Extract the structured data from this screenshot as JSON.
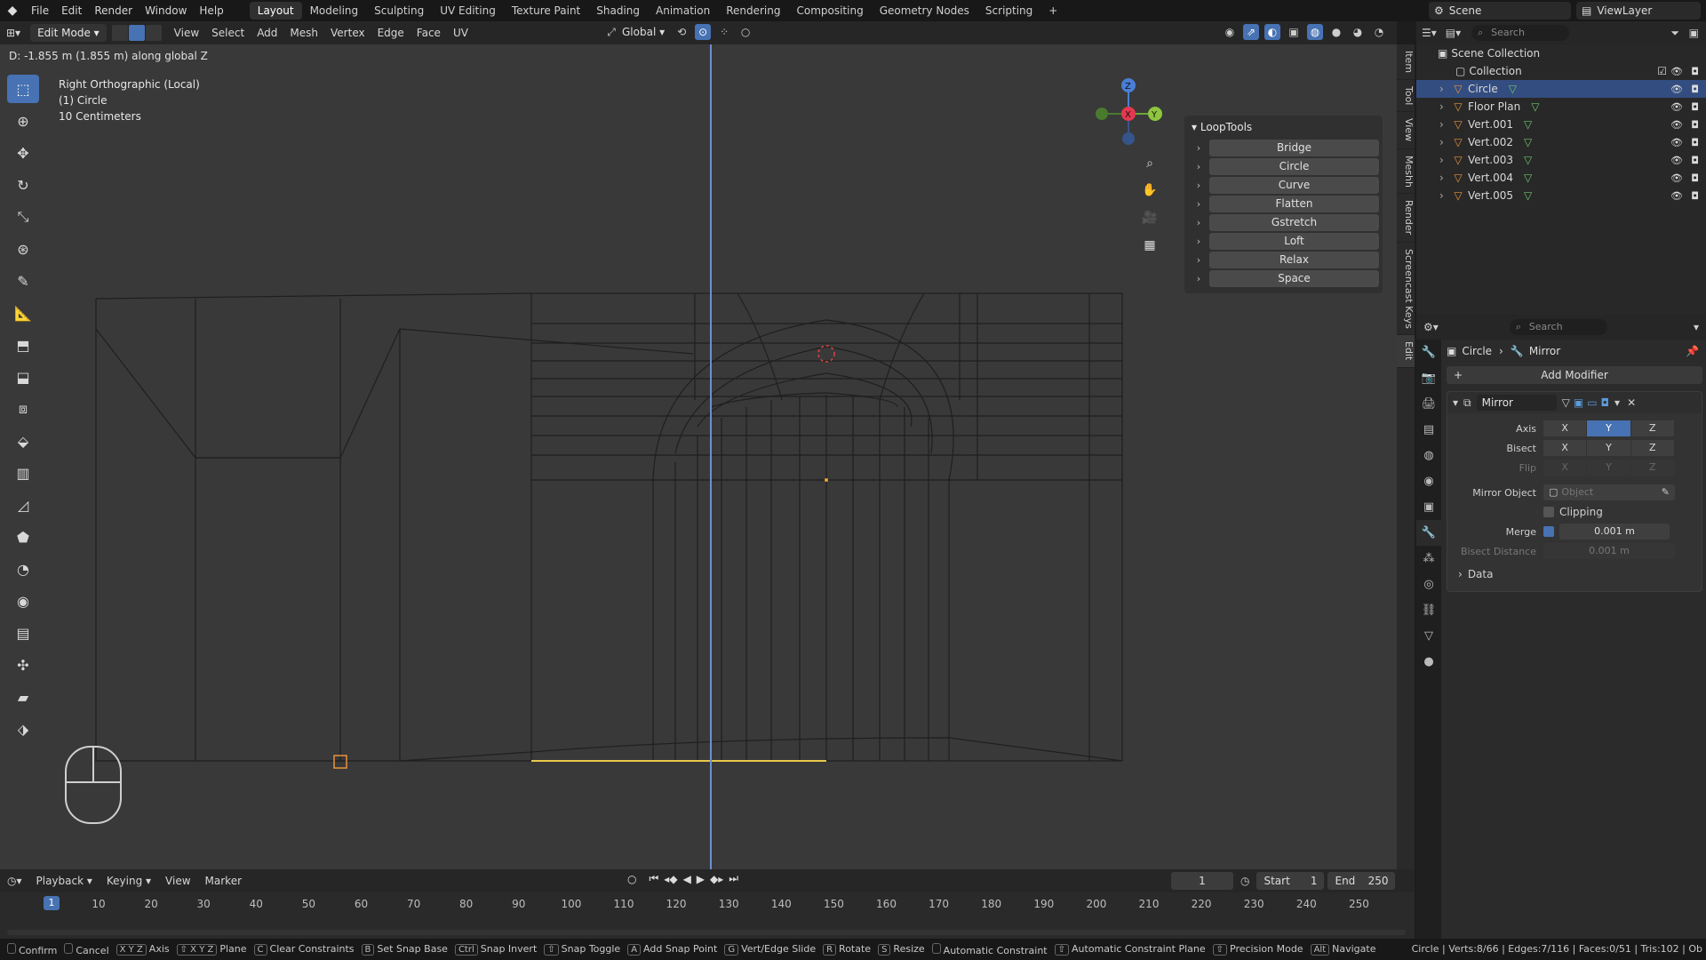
{
  "menu": {
    "items": [
      "File",
      "Edit",
      "Render",
      "Window",
      "Help"
    ],
    "workspaces": [
      "Layout",
      "Modeling",
      "Sculpting",
      "UV Editing",
      "Texture Paint",
      "Shading",
      "Animation",
      "Rendering",
      "Compositing",
      "Geometry Nodes",
      "Scripting"
    ],
    "active_workspace": "Layout",
    "scene": "Scene",
    "view_layer": "ViewLayer"
  },
  "viewport_header": {
    "mode": "Edit Mode",
    "menus": [
      "View",
      "Select",
      "Add",
      "Mesh",
      "Vertex",
      "Edge",
      "Face",
      "UV"
    ],
    "transform_orientation": "Global"
  },
  "viewport": {
    "status_line": "D: -1.855 m (1.855 m) along global Z",
    "view_name": "Right Orthographic (Local)",
    "object_name": "(1) Circle",
    "grid_scale": "10 Centimeters",
    "gizmo_axes": {
      "z": "Z",
      "x": "X",
      "y": "Y"
    }
  },
  "n_panel_tabs": [
    "Item",
    "Tool",
    "View",
    "Meshh",
    "Render",
    "Screencast Keys",
    "Edit"
  ],
  "looptools": {
    "title": "LoopTools",
    "items": [
      "Bridge",
      "Circle",
      "Curve",
      "Flatten",
      "Gstretch",
      "Loft",
      "Relax",
      "Space"
    ]
  },
  "timeline": {
    "menus": [
      "Playback",
      "Keying",
      "View",
      "Marker"
    ],
    "current_frame": "1",
    "start_label": "Start",
    "start": "1",
    "end_label": "End",
    "end": "250",
    "ruler": [
      "10",
      "20",
      "30",
      "40",
      "50",
      "60",
      "70",
      "80",
      "90",
      "100",
      "110",
      "120",
      "130",
      "140",
      "150",
      "160",
      "170",
      "180",
      "190",
      "200",
      "210",
      "220",
      "230",
      "240",
      "250"
    ],
    "cursor_frame": "1"
  },
  "statusbar": {
    "items": [
      {
        "key": "",
        "label": "Confirm"
      },
      {
        "key": "",
        "label": "Cancel"
      },
      {
        "key": "X Y Z",
        "label": "Axis"
      },
      {
        "key": "⇧ X Y Z",
        "label": "Plane"
      },
      {
        "key": "C",
        "label": "Clear Constraints"
      },
      {
        "key": "B",
        "label": "Set Snap Base"
      },
      {
        "key": "Ctrl",
        "label": "Snap Invert"
      },
      {
        "key": "⇧",
        "label": "Snap Toggle"
      },
      {
        "key": "A",
        "label": "Add Snap Point"
      },
      {
        "key": "G",
        "label": "Vert/Edge Slide"
      },
      {
        "key": "R",
        "label": "Rotate"
      },
      {
        "key": "S",
        "label": "Resize"
      },
      {
        "key": "",
        "label": "Automatic Constraint"
      },
      {
        "key": "⇧",
        "label": "Automatic Constraint Plane"
      },
      {
        "key": "⇧",
        "label": "Precision Mode"
      },
      {
        "key": "Alt",
        "label": "Navigate"
      }
    ],
    "stats": "Circle | Verts:8/66 | Edges:7/116 | Faces:0/51 | Tris:102 | Ob"
  },
  "outliner": {
    "search_placeholder": "Search",
    "scene_collection": "Scene Collection",
    "collection": "Collection",
    "objects": [
      {
        "name": "Circle",
        "selected": true
      },
      {
        "name": "Floor Plan",
        "selected": false
      },
      {
        "name": "Vert.001",
        "selected": false
      },
      {
        "name": "Vert.002",
        "selected": false
      },
      {
        "name": "Vert.003",
        "selected": false
      },
      {
        "name": "Vert.004",
        "selected": false
      },
      {
        "name": "Vert.005",
        "selected": false
      }
    ]
  },
  "properties": {
    "search_placeholder": "Search",
    "crumb_object": "Circle",
    "crumb_modifier": "Mirror",
    "add_modifier": "Add Modifier",
    "modifier_name": "Mirror",
    "axis_label": "Axis",
    "bisect_label": "Bisect",
    "flip_label": "Flip",
    "axes": [
      "X",
      "Y",
      "Z"
    ],
    "axis_active": "Y",
    "mirror_object_label": "Mirror Object",
    "mirror_object_placeholder": "Object",
    "clipping_label": "Clipping",
    "merge_label": "Merge",
    "merge_value": "0.001 m",
    "bisect_distance_label": "Bisect Distance",
    "bisect_distance_value": "0.001 m",
    "data_label": "Data"
  }
}
